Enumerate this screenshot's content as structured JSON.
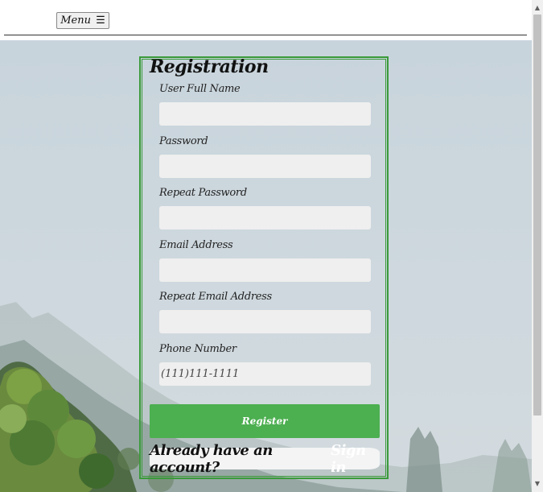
{
  "header": {
    "menu_label": "Menu",
    "menu_icon": "☰"
  },
  "form": {
    "title": "Registration",
    "fields": [
      {
        "label": "User Full Name",
        "value": "",
        "placeholder": ""
      },
      {
        "label": "Password",
        "value": "",
        "placeholder": ""
      },
      {
        "label": "Repeat Password",
        "value": "",
        "placeholder": ""
      },
      {
        "label": "Email Address",
        "value": "",
        "placeholder": ""
      },
      {
        "label": "Repeat Email Address",
        "value": "",
        "placeholder": ""
      },
      {
        "label": "Phone Number",
        "value": "",
        "placeholder": "(111)111-1111"
      }
    ],
    "register_label": "Register",
    "signin_prompt": "Already have an account?",
    "signin_link": "Sign in"
  },
  "scrollbar": {
    "up_arrow": "▲",
    "down_arrow": "▼"
  },
  "colors": {
    "accent": "#4caf50",
    "form_border": "#3a9a3a",
    "input_bg": "#efefef"
  }
}
